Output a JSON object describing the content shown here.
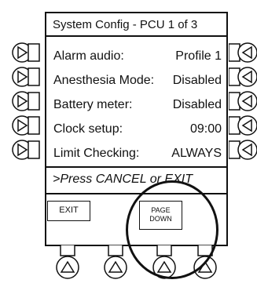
{
  "screen": {
    "title": "System Config - PCU 1 of 3",
    "rows": [
      {
        "label": "Alarm audio:",
        "value": "Profile 1"
      },
      {
        "label": "Anesthesia Mode:",
        "value": "Disabled"
      },
      {
        "label": "Battery meter:",
        "value": "Disabled"
      },
      {
        "label": "Clock setup:",
        "value": "09:00"
      },
      {
        "label": "Limit Checking:",
        "value": "ALWAYS"
      }
    ],
    "prompt": ">Press CANCEL or EXIT"
  },
  "softkeys": {
    "exit": "EXIT",
    "page_down_line1": "PAGE",
    "page_down_line2": "DOWN"
  },
  "icons": {
    "left_buttons": "triangle-right-icon",
    "right_buttons": "triangle-left-icon",
    "bottom_buttons": "triangle-up-icon"
  }
}
